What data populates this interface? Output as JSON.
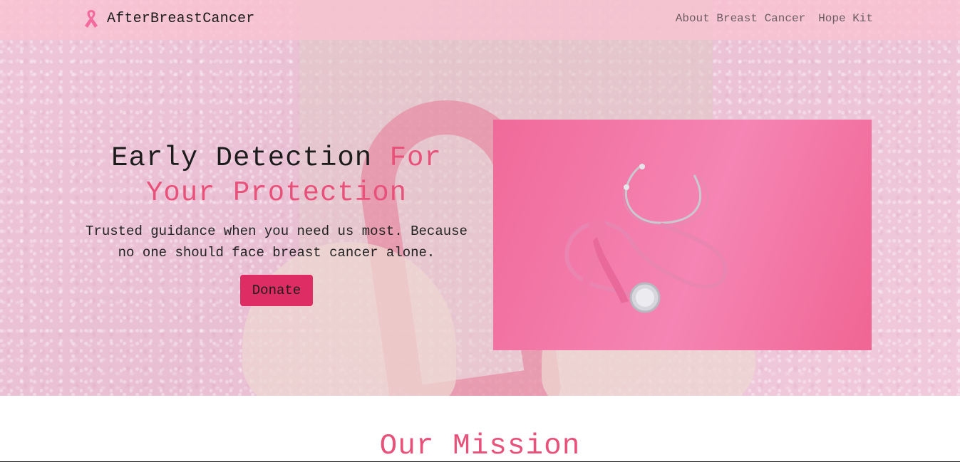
{
  "brand": {
    "name": "AfterBreastCancer",
    "icon": "pink-ribbon-icon"
  },
  "nav": {
    "links": [
      {
        "label": "About Breast Cancer"
      },
      {
        "label": "Hope Kit"
      }
    ]
  },
  "hero": {
    "headline_plain": "Early Detection ",
    "headline_accent": "For Your Protection",
    "lead": "Trusted guidance when you need us most. Because no one should face breast cancer alone.",
    "donate_label": "Donate",
    "image": "stethoscope-and-pink-ribbon"
  },
  "mission": {
    "title": "Our Mission"
  },
  "colors": {
    "accent": "#e8517a",
    "button": "#de2d64",
    "navbar": "#f8c3d2"
  }
}
